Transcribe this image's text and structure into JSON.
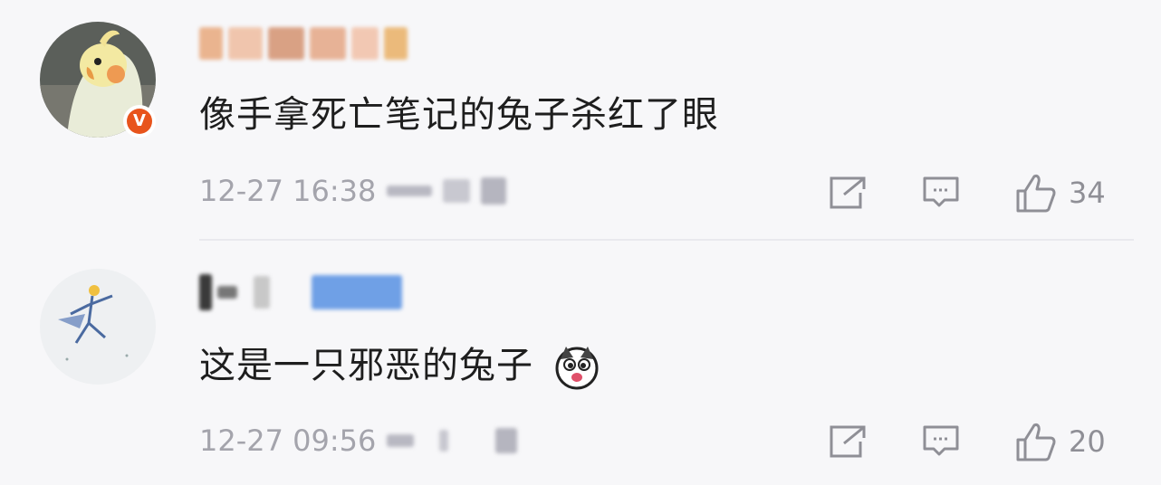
{
  "comments": [
    {
      "text": "像手拿死亡笔记的兔子杀红了眼",
      "time": "12-27 16:38",
      "likes": "34",
      "verified_badge": "V",
      "avatar_icon": "parrot-avatar",
      "colors": {
        "badge": "#e8541c"
      }
    },
    {
      "text": "这是一只邪恶的兔子",
      "time": "12-27 09:56",
      "likes": "20",
      "avatar_icon": "sketch-figure-avatar",
      "emoji_icon": "husky-face-emoji"
    }
  ],
  "icons": {
    "share": "share-arrow-icon",
    "reply": "comment-bubble-icon",
    "like": "thumbs-up-icon"
  }
}
